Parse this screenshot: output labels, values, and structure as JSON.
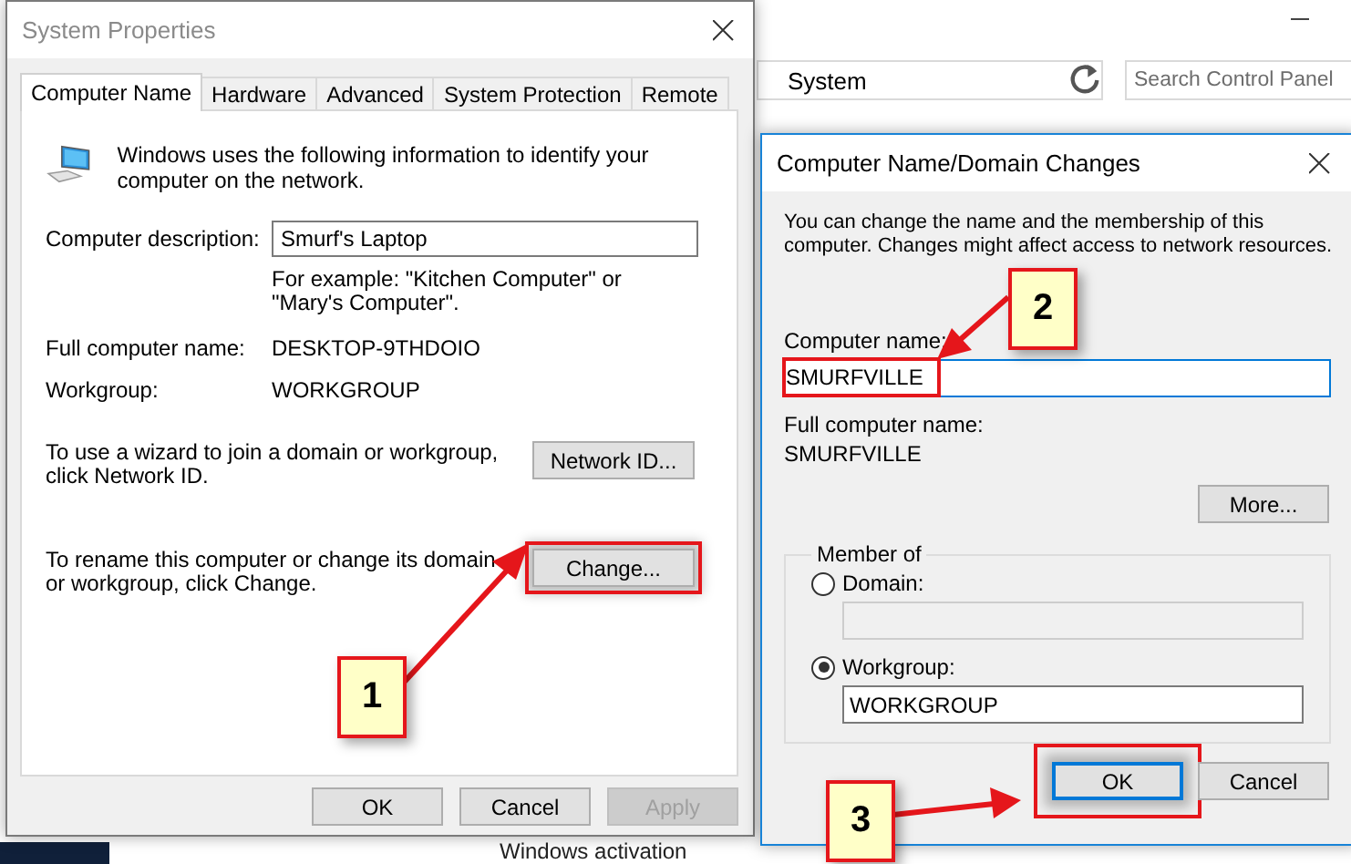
{
  "background_window": {
    "breadcrumb": "System",
    "search": {
      "placeholder": "Search Control Panel"
    },
    "footer_text": "Windows activation"
  },
  "system_properties": {
    "title": "System Properties",
    "tabs": [
      {
        "label": "Computer Name",
        "selected": true
      },
      {
        "label": "Hardware",
        "selected": false
      },
      {
        "label": "Advanced",
        "selected": false
      },
      {
        "label": "System Protection",
        "selected": false
      },
      {
        "label": "Remote",
        "selected": false
      }
    ],
    "intro": "Windows uses the following information to identify your computer on the network.",
    "description": {
      "label": "Computer description:",
      "value": "Smurf's Laptop",
      "example": "For example: \"Kitchen Computer\" or \"Mary's Computer\"."
    },
    "full_name": {
      "label": "Full computer name:",
      "value": "DESKTOP-9THDOIO"
    },
    "workgroup": {
      "label": "Workgroup:",
      "value": "WORKGROUP"
    },
    "actions": [
      {
        "text": "To use a wizard to join a domain or workgroup, click Network ID.",
        "button": "Network ID...",
        "highlighted": false
      },
      {
        "text": "To rename this computer or change its domain or workgroup, click Change.",
        "button": "Change...",
        "highlighted": true
      }
    ],
    "buttons": [
      {
        "label": "OK",
        "disabled": false
      },
      {
        "label": "Cancel",
        "disabled": false
      },
      {
        "label": "Apply",
        "disabled": true
      }
    ]
  },
  "name_changes": {
    "title": "Computer Name/Domain Changes",
    "intro": "You can change the name and the membership of this computer. Changes might affect access to network resources.",
    "computer_name": {
      "label": "Computer name:",
      "value": "SMURFVILLE",
      "highlighted": true
    },
    "full_name": {
      "label": "Full computer name:",
      "value": "SMURFVILLE"
    },
    "more_button": "More...",
    "member_of": {
      "label": "Member of",
      "options": [
        {
          "label": "Domain:",
          "selected": false
        },
        {
          "label": "Workgroup:",
          "selected": true,
          "value": "WORKGROUP"
        }
      ]
    },
    "buttons": [
      {
        "label": "OK",
        "focused": true,
        "highlighted": true
      },
      {
        "label": "Cancel",
        "focused": false,
        "highlighted": false
      }
    ]
  },
  "callouts": [
    {
      "number": "1"
    },
    {
      "number": "2"
    },
    {
      "number": "3"
    }
  ]
}
